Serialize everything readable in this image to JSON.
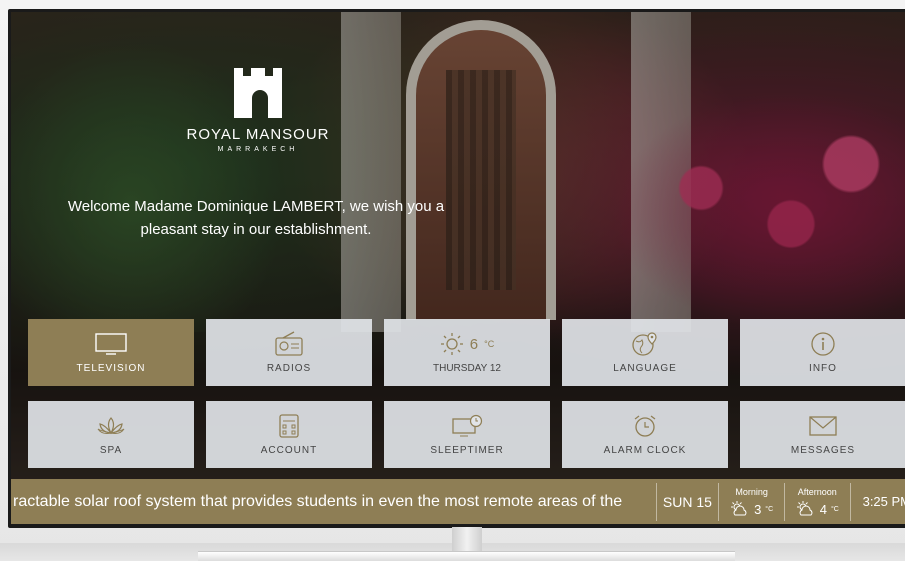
{
  "brand": {
    "name": "ROYAL MANSOUR",
    "city": "MARRAKECH"
  },
  "welcome": "Welcome Madame Dominique LAMBERT, we wish you a pleasant stay in our establishment.",
  "tiles": [
    {
      "label": "TELEVISION",
      "icon": "tv-icon",
      "active": true
    },
    {
      "label": "RADIOS",
      "icon": "radio-icon"
    },
    {
      "label": "THURSDAY 12",
      "icon": "sun-icon",
      "temp": "6",
      "unit": "°C"
    },
    {
      "label": "LANGUAGE",
      "icon": "globe-icon"
    },
    {
      "label": "INFO",
      "icon": "info-icon"
    },
    {
      "label": "SPA",
      "icon": "lotus-icon"
    },
    {
      "label": "ACCOUNT",
      "icon": "account-icon"
    },
    {
      "label": "SLEEPTIMER",
      "icon": "sleeptimer-icon"
    },
    {
      "label": "ALARM CLOCK",
      "icon": "alarm-clock-icon"
    },
    {
      "label": "MESSAGES",
      "icon": "envelope-icon"
    }
  ],
  "ticker": {
    "text": "ractable solar roof system that provides students in even the most remote areas of the",
    "date": "SUN 15",
    "forecast": [
      {
        "period": "Morning",
        "temp": "3",
        "unit": "°C",
        "icon": "cloudy-sun-icon"
      },
      {
        "period": "Afternoon",
        "temp": "4",
        "unit": "°C",
        "icon": "cloudy-sun-icon"
      }
    ],
    "time": "3:25 PM"
  },
  "colors": {
    "accent": "#8e7e55",
    "tile_bg": "#e1e4e8",
    "tile_text": "#444444"
  }
}
